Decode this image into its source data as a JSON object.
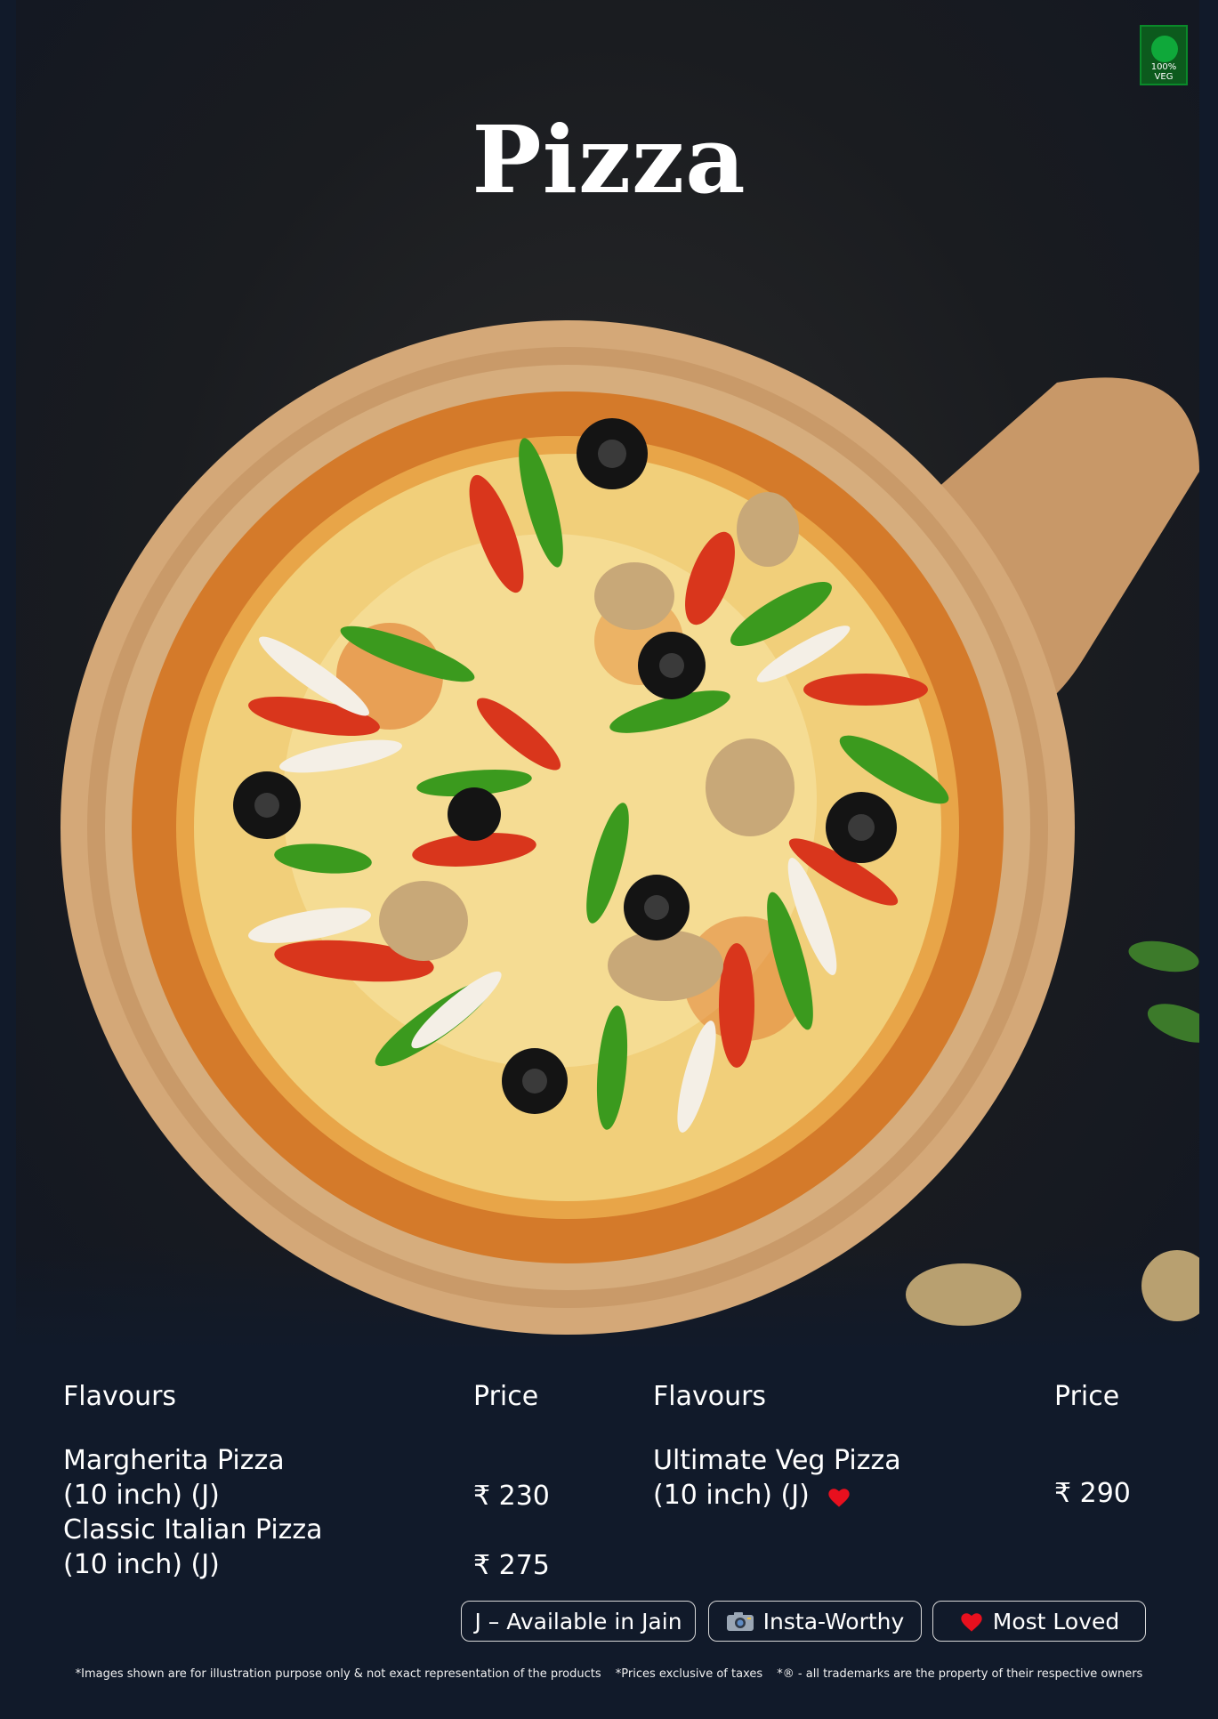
{
  "badge": {
    "veg_label": "100% VEG",
    "color": "#0fa83a"
  },
  "title": "Pizza",
  "menu": {
    "left_column": {
      "flavours_header": "Flavours",
      "price_header": "Price",
      "items": [
        {
          "name_line1": "Margherita Pizza",
          "name_line2": "(10 inch) (J)",
          "price": "₹ 230"
        },
        {
          "name_line1": "Classic Italian Pizza",
          "name_line2": "(10 inch) (J)",
          "price": "₹ 275"
        }
      ]
    },
    "right_column": {
      "flavours_header": "Flavours",
      "price_header": "Price",
      "items": [
        {
          "name_line1": "Ultimate Veg Pizza",
          "name_line2": "(10 inch) (J)",
          "price": "₹ 290",
          "most_loved": true
        }
      ]
    }
  },
  "legend": {
    "jain": "J – Available in Jain",
    "insta": "Insta-Worthy",
    "loved": "Most Loved",
    "insta_icon": "camera-icon",
    "loved_icon": "heart-icon",
    "heart_color": "#e8101e"
  },
  "disclaimer": {
    "images": "*Images shown are for illustration purpose only & not exact representation of the products",
    "prices": "*Prices exclusive of taxes",
    "trademarks": "*® - all trademarks are the property of their respective owners"
  }
}
